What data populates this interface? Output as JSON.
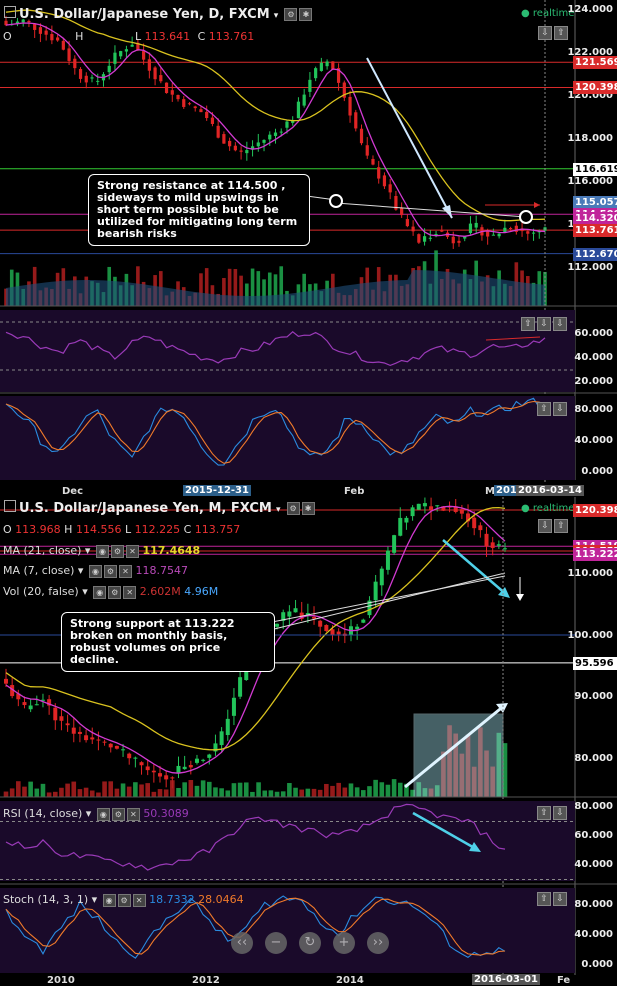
{
  "top": {
    "title": "U.S. Dollar/Japanese Yen, D, FXCM",
    "realtime": "realtime",
    "ohlc": {
      "o_label": "O",
      "o": "",
      "h_label": "H",
      "h": "",
      "l_label": "L",
      "l": "113.641",
      "c_label": "C",
      "c": "113.761"
    },
    "price_ticks": [
      "124.000",
      "122.000",
      "120.000",
      "118.000",
      "116.000",
      "114.000",
      "112.000"
    ],
    "price_labels": [
      {
        "value": "121.569",
        "color": "#d92a2a"
      },
      {
        "value": "120.398",
        "color": "#d92a2a"
      },
      {
        "value": "115.057",
        "color": "#4a7ab8"
      },
      {
        "value": "116.619",
        "color": "#ffffff"
      },
      {
        "value": "114.500",
        "color": "#c0249a"
      },
      {
        "value": "114.320",
        "color": "#c0249a"
      },
      {
        "value": "113.761",
        "color": "#d92a2a"
      },
      {
        "value": "112.670",
        "color": "#2a4a9a"
      }
    ],
    "annotation": "Strong resistance at 114.500 , sideways to mild upswings in short term possible but to be utilized for mitigating long term bearish risks",
    "rsi_ticks": [
      "60.000",
      "40.000",
      "20.000"
    ],
    "stoch_ticks": [
      "80.000",
      "40.000",
      "0.000"
    ],
    "x_labels": [
      "Dec",
      "Feb",
      "M"
    ],
    "x_highlight_1": "2015-12-31",
    "x_highlight_2": "201",
    "x_highlight_3": "2016-03-14"
  },
  "bottom": {
    "title": "U.S. Dollar/Japanese Yen, M, FXCM",
    "realtime": "realtime",
    "ohlc": {
      "o_label": "O",
      "o": "113.968",
      "h_label": "H",
      "h": "114.556",
      "l_label": "L",
      "l": "112.225",
      "c_label": "C",
      "c": "113.757"
    },
    "ma21": {
      "label": "MA (21, close)",
      "value": "117.4648"
    },
    "ma7": {
      "label": "MA (7, close)",
      "value": "118.7547"
    },
    "vol": {
      "label": "Vol (20, false)",
      "value1": "2.602M",
      "value2": "4.96M"
    },
    "price_ticks": [
      "110.000",
      "100.000",
      "90.000",
      "80.000"
    ],
    "price_labels": [
      {
        "value": "120.398",
        "color": "#d92a2a"
      },
      {
        "value": "114.519",
        "color": "#c0249a"
      },
      {
        "value": "113.757",
        "color": "#d92a2a"
      },
      {
        "value": "113.222",
        "color": "#c0249a"
      },
      {
        "value": "95.596",
        "color": "#ffffff"
      }
    ],
    "annotation": "Strong support at 113.222 broken on monthly basis, robust volumes on price decline.",
    "rsi": {
      "label": "RSI (14, close)",
      "value": "50.3089"
    },
    "rsi_ticks": [
      "80.000",
      "60.000",
      "40.000"
    ],
    "stoch": {
      "label": "Stoch (14, 3, 1)",
      "value1": "18.7332",
      "value2": "28.0464"
    },
    "stoch_ticks": [
      "80.000",
      "40.000",
      "0.000"
    ],
    "x_labels": [
      "2010",
      "2012",
      "2014",
      "Fe"
    ],
    "x_highlight": "2016-03-01"
  },
  "zoom_buttons": [
    "‹‹",
    "−",
    "↻",
    "+",
    "››"
  ],
  "colors": {
    "up": "#22c45a",
    "down": "#e02525",
    "ma_yellow": "#d9c21f",
    "ma_magenta": "#d23ad2",
    "rsi": "#9a3ab8",
    "stoch_k": "#2a8be0",
    "stoch_d": "#f07a2a"
  }
}
